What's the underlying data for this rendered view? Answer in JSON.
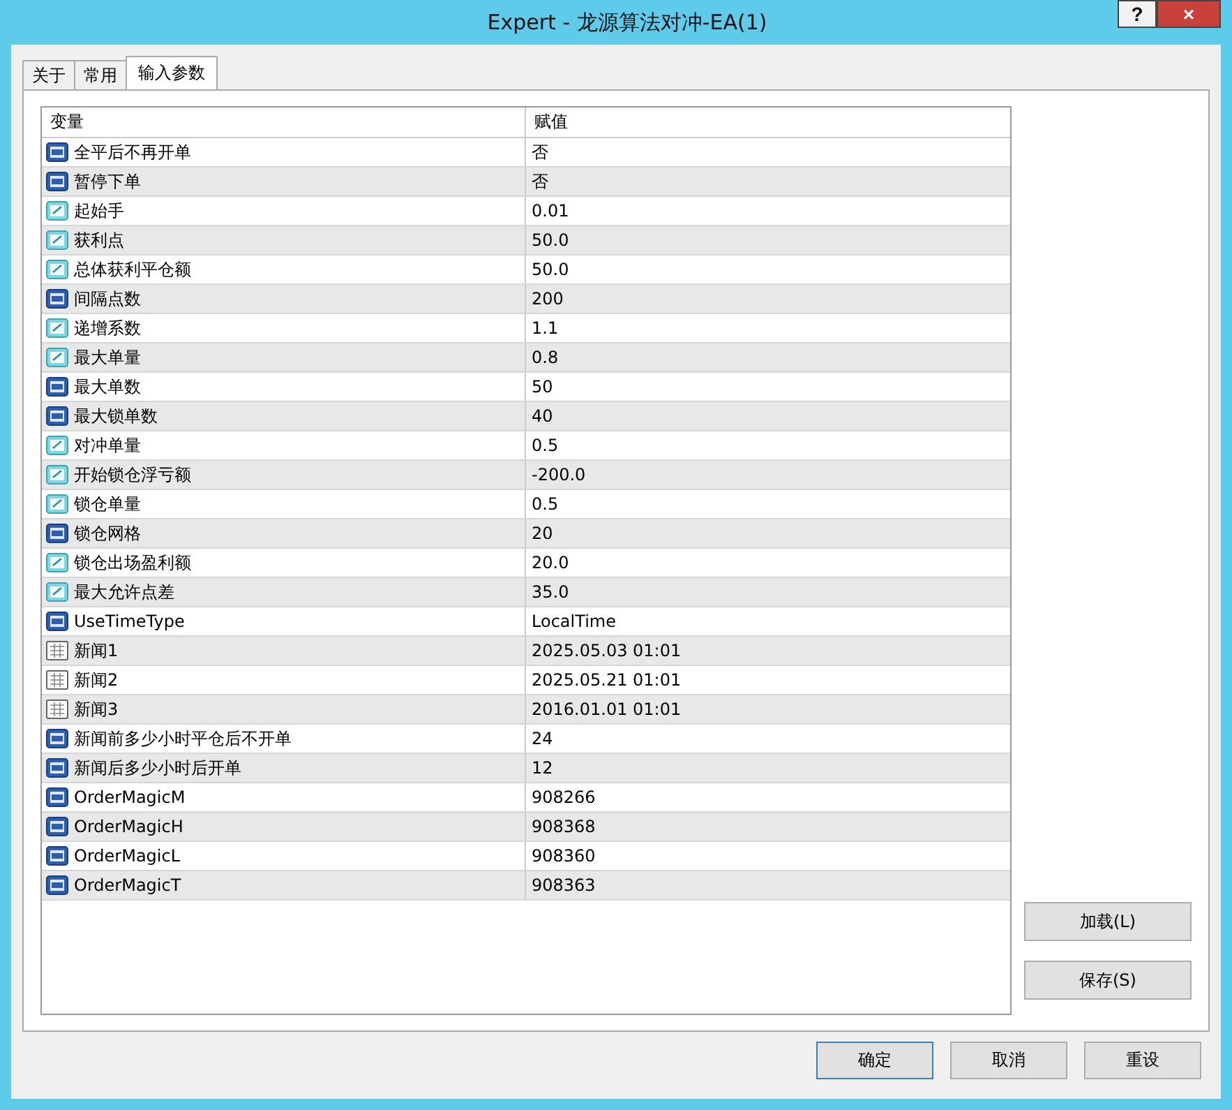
{
  "window": {
    "title": "Expert - 龙源算法对冲-EA(1)",
    "help_button": "?",
    "close_button": "×"
  },
  "tabs": [
    {
      "label": "关于",
      "selected": false
    },
    {
      "label": "常用",
      "selected": false
    },
    {
      "label": "输入参数",
      "selected": true
    }
  ],
  "table": {
    "columns": [
      "变量",
      "赋值"
    ],
    "rows": [
      {
        "kind": "int",
        "name": "全平后不再开单",
        "value": "否"
      },
      {
        "kind": "int",
        "name": "暂停下单",
        "value": "否"
      },
      {
        "kind": "double",
        "name": "起始手",
        "value": "0.01"
      },
      {
        "kind": "double",
        "name": "获利点",
        "value": "50.0"
      },
      {
        "kind": "double",
        "name": "总体获利平仓额",
        "value": "50.0"
      },
      {
        "kind": "int",
        "name": "间隔点数",
        "value": "200"
      },
      {
        "kind": "double",
        "name": "递增系数",
        "value": "1.1"
      },
      {
        "kind": "double",
        "name": "最大单量",
        "value": "0.8"
      },
      {
        "kind": "int",
        "name": "最大单数",
        "value": "50"
      },
      {
        "kind": "int",
        "name": "最大锁单数",
        "value": "40"
      },
      {
        "kind": "double",
        "name": "对冲单量",
        "value": "0.5"
      },
      {
        "kind": "double",
        "name": "开始锁仓浮亏额",
        "value": "-200.0"
      },
      {
        "kind": "double",
        "name": "锁仓单量",
        "value": "0.5"
      },
      {
        "kind": "int",
        "name": "锁仓网格",
        "value": "20"
      },
      {
        "kind": "double",
        "name": "锁仓出场盈利额",
        "value": "20.0"
      },
      {
        "kind": "double",
        "name": "最大允许点差",
        "value": "35.0"
      },
      {
        "kind": "int",
        "name": "UseTimeType",
        "value": "LocalTime"
      },
      {
        "kind": "datetime",
        "name": "新闻1",
        "value": "2025.05.03 01:01"
      },
      {
        "kind": "datetime",
        "name": "新闻2",
        "value": "2025.05.21 01:01"
      },
      {
        "kind": "datetime",
        "name": "新闻3",
        "value": "2016.01.01 01:01"
      },
      {
        "kind": "int",
        "name": "新闻前多少小时平仓后不开单",
        "value": "24"
      },
      {
        "kind": "int",
        "name": "新闻后多少小时后开单",
        "value": "12"
      },
      {
        "kind": "int",
        "name": "OrderMagicM",
        "value": "908266"
      },
      {
        "kind": "int",
        "name": "OrderMagicH",
        "value": "908368"
      },
      {
        "kind": "int",
        "name": "OrderMagicL",
        "value": "908360"
      },
      {
        "kind": "int",
        "name": "OrderMagicT",
        "value": "908363"
      }
    ]
  },
  "side_buttons": [
    "加载(L)",
    "保存(S)"
  ],
  "buttons": [
    {
      "label": "确定",
      "default": true
    },
    {
      "label": "取消",
      "default": false
    },
    {
      "label": "重设",
      "default": false
    }
  ]
}
